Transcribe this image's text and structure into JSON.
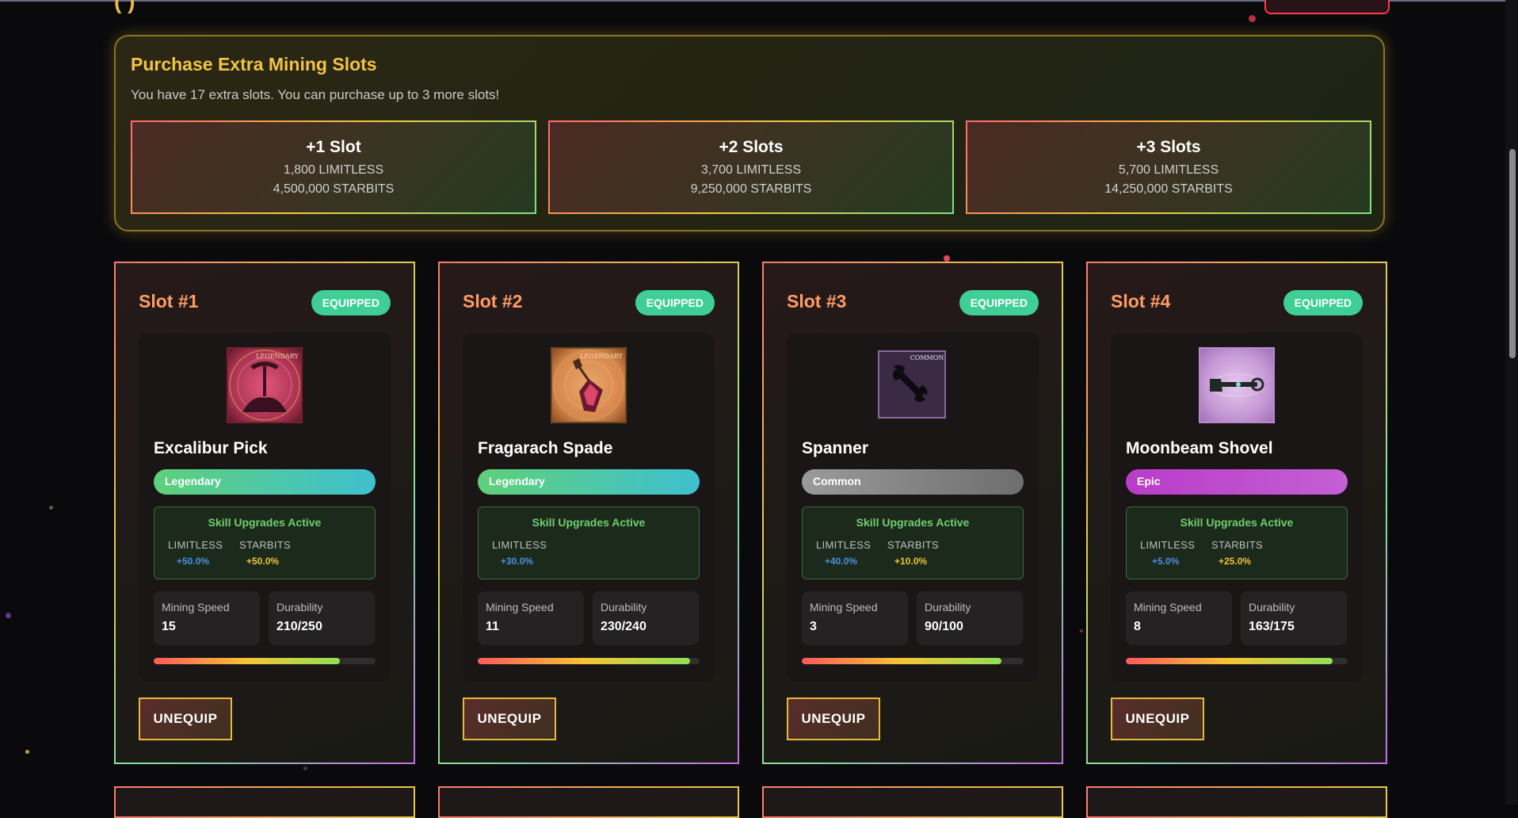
{
  "purchase": {
    "title": "Purchase Extra Mining Slots",
    "subtitle": "You have 17 extra slots. You can purchase up to 3 more slots!",
    "options": [
      {
        "label": "+1 Slot",
        "limitless": "1,800 LIMITLESS",
        "starbits": "4,500,000 STARBITS"
      },
      {
        "label": "+2 Slots",
        "limitless": "3,700 LIMITLESS",
        "starbits": "9,250,000 STARBITS"
      },
      {
        "label": "+3 Slots",
        "limitless": "5,700 LIMITLESS",
        "starbits": "14,250,000 STARBITS"
      }
    ]
  },
  "slots": [
    {
      "title": "Slot #1",
      "status": "EQUIPPED",
      "tool_name": "Excalibur Pick",
      "rarity": "Legendary",
      "image_badge": "LEGENDARY",
      "icon": "excalibur-pick-icon",
      "skills_title": "Skill Upgrades Active",
      "skills": [
        {
          "key": "LIMITLESS",
          "value": "+50.0%"
        },
        {
          "key": "STARBITS",
          "value": "+50.0%"
        }
      ],
      "mining_speed_label": "Mining Speed",
      "mining_speed": "15",
      "durability_label": "Durability",
      "durability": "210/250",
      "durability_fraction": 0.84,
      "action": "UNEQUIP"
    },
    {
      "title": "Slot #2",
      "status": "EQUIPPED",
      "tool_name": "Fragarach Spade",
      "rarity": "Legendary",
      "image_badge": "LEGENDARY",
      "icon": "fragarach-spade-icon",
      "skills_title": "Skill Upgrades Active",
      "skills": [
        {
          "key": "LIMITLESS",
          "value": "+30.0%"
        }
      ],
      "mining_speed_label": "Mining Speed",
      "mining_speed": "11",
      "durability_label": "Durability",
      "durability": "230/240",
      "durability_fraction": 0.958,
      "action": "UNEQUIP"
    },
    {
      "title": "Slot #3",
      "status": "EQUIPPED",
      "tool_name": "Spanner",
      "rarity": "Common",
      "image_badge": "COMMON",
      "icon": "spanner-icon",
      "skills_title": "Skill Upgrades Active",
      "skills": [
        {
          "key": "LIMITLESS",
          "value": "+40.0%"
        },
        {
          "key": "STARBITS",
          "value": "+10.0%"
        }
      ],
      "mining_speed_label": "Mining Speed",
      "mining_speed": "3",
      "durability_label": "Durability",
      "durability": "90/100",
      "durability_fraction": 0.9,
      "action": "UNEQUIP"
    },
    {
      "title": "Slot #4",
      "status": "EQUIPPED",
      "tool_name": "Moonbeam Shovel",
      "rarity": "Epic",
      "image_badge": "",
      "icon": "moonbeam-shovel-icon",
      "skills_title": "Skill Upgrades Active",
      "skills": [
        {
          "key": "LIMITLESS",
          "value": "+5.0%"
        },
        {
          "key": "STARBITS",
          "value": "+25.0%"
        }
      ],
      "mining_speed_label": "Mining Speed",
      "mining_speed": "8",
      "durability_label": "Durability",
      "durability": "163/175",
      "durability_fraction": 0.931,
      "action": "UNEQUIP"
    }
  ],
  "colors": {
    "accent_gold": "#f3c346",
    "slot_title": "#ff9c64",
    "equipped_badge": "#3fcf95",
    "limitless_value": "#4a90e2",
    "starbits_value": "#f0c23a",
    "legendary_gradient": [
      "#5fd07a",
      "#3fbfd0"
    ],
    "common_gradient": [
      "#9a9a9a",
      "#6e6e6e"
    ],
    "epic_gradient": [
      "#b93cc9",
      "#c45fd4"
    ]
  }
}
